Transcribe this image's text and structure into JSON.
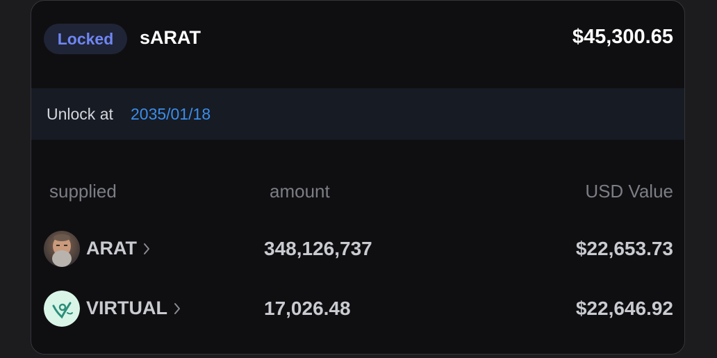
{
  "header": {
    "badge": "Locked",
    "token": "sARAT",
    "total_value": "$45,300.65"
  },
  "unlock": {
    "label": "Unlock at",
    "date": "2035/01/18"
  },
  "columns": {
    "supplied": "supplied",
    "amount": "amount",
    "usd": "USD Value"
  },
  "rows": [
    {
      "symbol": "ARAT",
      "icon": "arat-avatar-icon",
      "amount": "348,126,737",
      "usd": "$22,653.73"
    },
    {
      "symbol": "VIRTUAL",
      "icon": "virtual-logo-icon",
      "amount": "17,026.48",
      "usd": "$22,646.92"
    }
  ],
  "colors": {
    "badge_text": "#6f86f2",
    "date_link": "#3b8eea",
    "card_bg": "#0f0f11",
    "unlock_bg": "#171b24"
  }
}
